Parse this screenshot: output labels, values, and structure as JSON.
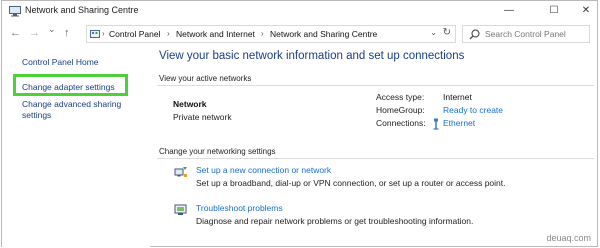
{
  "window": {
    "title": "Network and Sharing Centre",
    "controls": {
      "minimize": "—",
      "maximize": "☐",
      "close": "✕"
    }
  },
  "nav": {
    "back": "←",
    "forward": "→",
    "recent": "⌄",
    "up": "↑"
  },
  "address": {
    "crumbs": [
      "Control Panel",
      "Network and Internet",
      "Network and Sharing Centre"
    ],
    "separator": "›",
    "dropdown": "⌄",
    "refresh": "↻"
  },
  "search": {
    "placeholder": "Search Control Panel"
  },
  "left_pane": {
    "home": "Control Panel Home",
    "links": [
      {
        "label": "Change adapter settings",
        "highlighted": true
      },
      {
        "label_lines": [
          "Change advanced sharing",
          "settings"
        ]
      }
    ],
    "highlight_color": "#4cd13a"
  },
  "main": {
    "title": "View your basic network information and set up connections",
    "active_networks_label": "View your active networks",
    "network": {
      "name": "Network",
      "category": "Private network",
      "access_type_label": "Access type:",
      "access_type_value": "Internet",
      "homegroup_label": "HomeGroup:",
      "homegroup_value": "Ready to create",
      "connections_label": "Connections:",
      "connections_value": "Ethernet"
    },
    "settings_label": "Change your networking settings",
    "tasks": [
      {
        "icon": "new-connection-icon",
        "link": "Set up a new connection or network",
        "description": "Set up a broadband, dial-up or VPN connection, or set up a router or access point."
      },
      {
        "icon": "troubleshoot-icon",
        "link": "Troubleshoot problems",
        "description": "Diagnose and repair network problems or get troubleshooting information."
      }
    ]
  },
  "watermark": "deuaq.com",
  "colors": {
    "link": "#1a6dcc",
    "nav_link": "#1a3e84",
    "title_blue": "#1a3e84"
  }
}
